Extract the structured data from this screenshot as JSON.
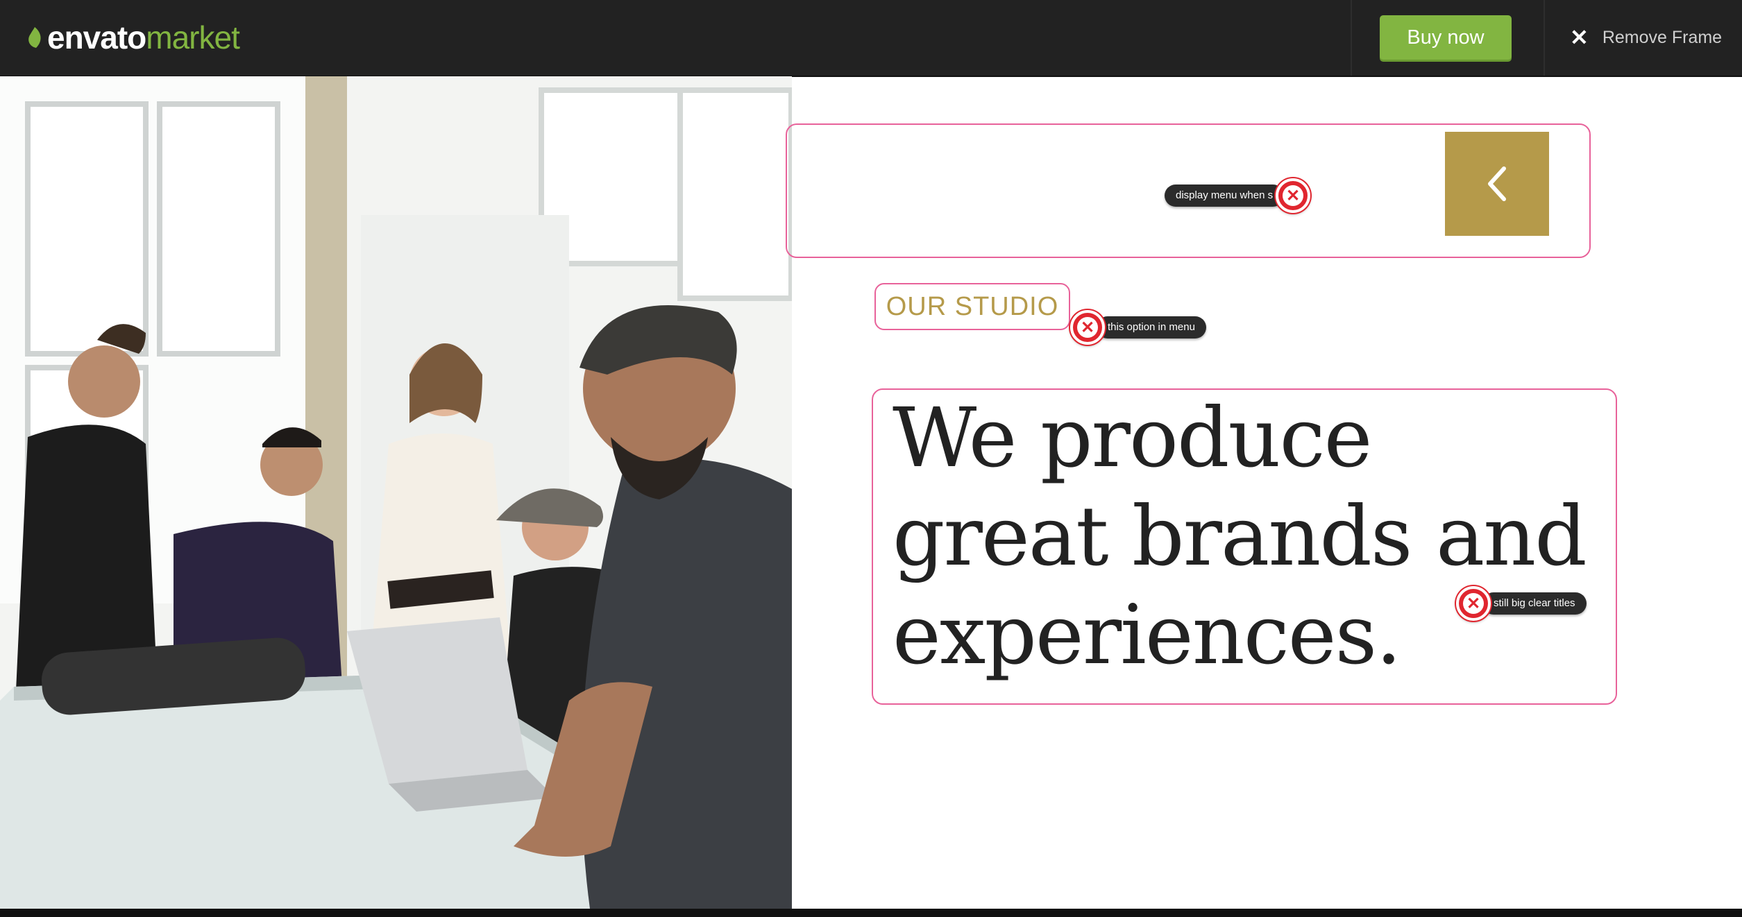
{
  "topbar": {
    "logo_part1": "envato",
    "logo_part2": "market",
    "buy_label": "Buy now",
    "remove_frame_label": "Remove Frame",
    "remove_frame_icon": "close-icon"
  },
  "hero": {
    "menu_button_icon": "chevron-left-icon",
    "section_label": "OUR STUDIO",
    "headline": "We produce great brands and experiences."
  },
  "annotations": [
    {
      "text": "display menu when s"
    },
    {
      "text": "this option in menu"
    },
    {
      "text": "still big clear titles"
    }
  ],
  "colors": {
    "brand_green": "#82b541",
    "accent_gold": "#b59a4a",
    "annotation_outline": "#e8629a",
    "annotation_red": "#e0262f"
  }
}
